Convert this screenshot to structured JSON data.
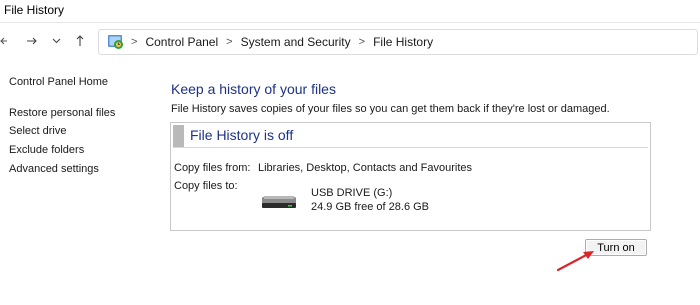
{
  "window": {
    "title": "File History"
  },
  "nav": {
    "back_icon": "arrow-left-icon",
    "forward_icon": "arrow-right-icon",
    "recent_icon": "chevron-down-icon",
    "up_icon": "arrow-up-icon"
  },
  "address": {
    "icon": "control-panel-icon",
    "crumbs": [
      "Control Panel",
      "System and Security",
      "File History"
    ]
  },
  "sidebar": {
    "home": "Control Panel Home",
    "items": [
      "Restore personal files",
      "Select drive",
      "Exclude folders",
      "Advanced settings"
    ]
  },
  "main": {
    "title": "Keep a history of your files",
    "description": "File History saves copies of your files so you can get them back if they're lost or damaged.",
    "panel": {
      "title": "File History is off",
      "copy_from_label": "Copy files from:",
      "copy_from_value": "Libraries, Desktop, Contacts and Favourites",
      "copy_to_label": "Copy files to:",
      "drive_icon": "usb-drive-icon",
      "drive_name": "USB DRIVE (G:)",
      "drive_space": "24.9 GB free of 28.6 GB"
    },
    "turn_on_label": "Turn on"
  },
  "annotation": {
    "arrow_color": "#d9262b"
  },
  "colors": {
    "heading": "#1e3287"
  }
}
